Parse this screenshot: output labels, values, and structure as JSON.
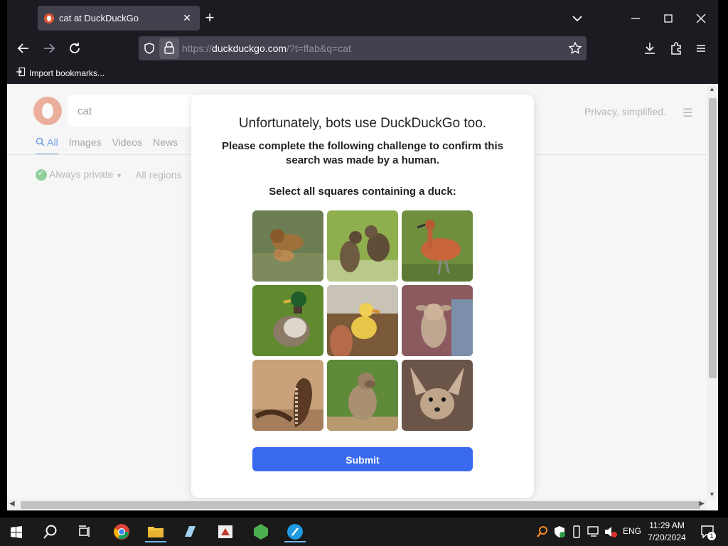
{
  "browser": {
    "tab_title": "cat at DuckDuckGo",
    "url_prefix": "https://",
    "url_host": "duckduckgo.com",
    "url_path": "/?t=ffab&q=cat",
    "bookmark_label": "Import bookmarks..."
  },
  "page": {
    "search_query": "cat",
    "tabs": [
      "All",
      "Images",
      "Videos",
      "News"
    ],
    "privacy_text": "Privacy, simplified.",
    "filter_private": "Always private",
    "filter_region": "All regions"
  },
  "challenge": {
    "title": "Unfortunately, bots use DuckDuckGo too.",
    "subtitle": "Please complete the following challenge to confirm this search was made by a human.",
    "instruction": "Select all squares containing a duck:",
    "tiles": [
      {
        "name": "lion-tile",
        "subject": "lions"
      },
      {
        "name": "cats-tile",
        "subject": "tabby cats"
      },
      {
        "name": "whistling-duck-tile",
        "subject": "whistling duck"
      },
      {
        "name": "mallard-tile",
        "subject": "mallard duck"
      },
      {
        "name": "duckling-tile",
        "subject": "yellow duckling"
      },
      {
        "name": "goat-tile",
        "subject": "baby goat"
      },
      {
        "name": "cobra-tile",
        "subject": "cobra"
      },
      {
        "name": "baboon-tile",
        "subject": "baboon"
      },
      {
        "name": "fennec-tile",
        "subject": "fox"
      }
    ],
    "submit_label": "Submit"
  },
  "taskbar": {
    "language": "ENG",
    "time": "11:29 AM",
    "date": "7/20/2024",
    "notification_count": "1"
  },
  "colors": {
    "accent": "#3969ef",
    "ddg_orange": "#de5833",
    "chrome_bg": "#1c1b22"
  }
}
